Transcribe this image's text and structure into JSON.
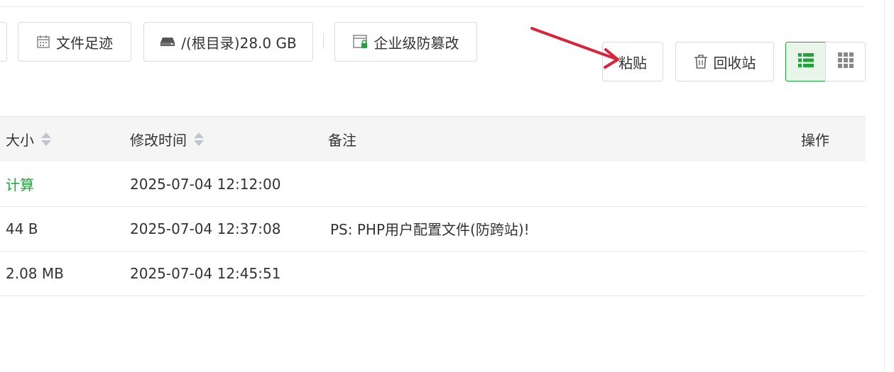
{
  "toolbar": {
    "footprint_label": "文件足迹",
    "disk_label": "/(根目录)28.0 GB",
    "tamper_label": "企业级防篡改",
    "paste_label": "粘贴",
    "recycle_label": "回收站"
  },
  "table": {
    "headers": {
      "size": "大小",
      "mtime": "修改时间",
      "remark": "备注",
      "action": "操作"
    },
    "rows": [
      {
        "size": "计算",
        "mtime": "2025-07-04 12:12:00",
        "remark": ""
      },
      {
        "size": "44 B",
        "mtime": "2025-07-04 12:37:08",
        "remark": "PS: PHP用户配置文件(防跨站)!"
      },
      {
        "size": "2.08 MB",
        "mtime": "2025-07-04 12:45:51",
        "remark": ""
      }
    ]
  },
  "colors": {
    "accent": "#20a53a",
    "annotation_arrow": "#d9233a"
  },
  "icons": [
    "calendar-icon",
    "disk-icon",
    "shield-window-icon",
    "trash-icon",
    "list-view-icon",
    "grid-view-icon",
    "sort-icon",
    "annotation-arrow"
  ]
}
